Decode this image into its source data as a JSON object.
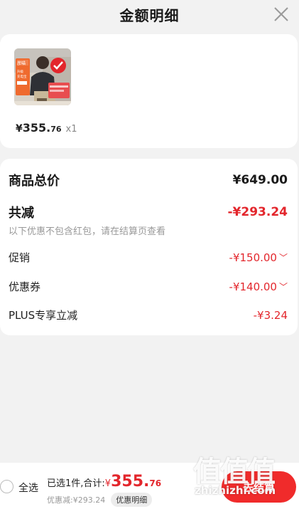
{
  "header": {
    "title": "金额明细"
  },
  "product": {
    "price_yen": "¥",
    "price_int": "355.",
    "price_dec": "76",
    "quantity": "x1",
    "thumb_lines": [
      "彦喵",
      "升级",
      "充电宝"
    ]
  },
  "details": {
    "total_label": "商品总价",
    "total_value": "¥649.00",
    "reduce_label": "共减",
    "reduce_value": "-¥293.24",
    "note": "以下优惠不包含红包，请在结算页查看",
    "promo_label": "促销",
    "promo_value": "-¥150.00",
    "coupon_label": "优惠券",
    "coupon_value": "-¥140.00",
    "plus_label": "PLUS专享立减",
    "plus_value": "-¥3.24",
    "chevron": "﹀"
  },
  "footer": {
    "select_all": "全选",
    "selected_text": "已选1件,合计:",
    "total_yen": "¥",
    "total_int": "355.",
    "total_dec": "76",
    "discount_text": "优惠减:¥293.24",
    "detail_button": "优惠明细",
    "checkout_button": "去结算"
  },
  "watermark": {
    "logo": "值值值",
    "text": "zhizhizhi.com"
  },
  "colors": {
    "accent": "#e3262c",
    "checkout": "#f02b2b"
  }
}
